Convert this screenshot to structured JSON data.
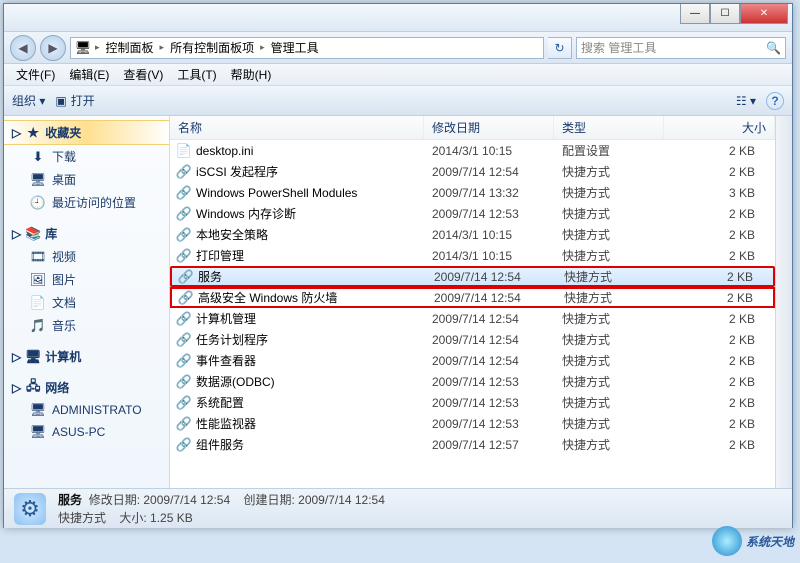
{
  "titlebar": {
    "minimize": "—",
    "maximize": "☐",
    "close": "✕"
  },
  "nav": {
    "back": "◀",
    "forward": "▶"
  },
  "breadcrumb": {
    "root_icon": "🖥",
    "items": [
      "控制面板",
      "所有控制面板项",
      "管理工具"
    ],
    "refresh": "↻"
  },
  "search": {
    "placeholder": "搜索 管理工具",
    "icon": "🔍"
  },
  "menubar": [
    "文件(F)",
    "编辑(E)",
    "查看(V)",
    "工具(T)",
    "帮助(H)"
  ],
  "toolbar": {
    "organize": "组织 ▾",
    "open_icon": "▣",
    "open": "打开",
    "view_icon": "☷ ▾",
    "help_icon": "?"
  },
  "sidebar": {
    "favorites": {
      "label": "收藏夹",
      "icon": "★",
      "expand": "▷",
      "items": [
        {
          "icon": "⬇",
          "label": "下载"
        },
        {
          "icon": "🖥",
          "label": "桌面"
        },
        {
          "icon": "🕘",
          "label": "最近访问的位置"
        }
      ]
    },
    "libraries": {
      "label": "库",
      "icon": "📚",
      "expand": "▷",
      "items": [
        {
          "icon": "🎞",
          "label": "视频"
        },
        {
          "icon": "🖼",
          "label": "图片"
        },
        {
          "icon": "📄",
          "label": "文档"
        },
        {
          "icon": "🎵",
          "label": "音乐"
        }
      ]
    },
    "computer": {
      "label": "计算机",
      "icon": "🖥",
      "expand": "▷"
    },
    "network": {
      "label": "网络",
      "icon": "🖧",
      "expand": "▷",
      "items": [
        {
          "icon": "🖥",
          "label": "ADMINISTRATO"
        },
        {
          "icon": "🖥",
          "label": "ASUS-PC"
        }
      ]
    }
  },
  "columns": {
    "name": "名称",
    "date": "修改日期",
    "type": "类型",
    "size": "大小"
  },
  "files": [
    {
      "icon": "📄",
      "name": "desktop.ini",
      "date": "2014/3/1 10:15",
      "type": "配置设置",
      "size": "2 KB",
      "sel": false,
      "hl": false
    },
    {
      "icon": "🔗",
      "name": "iSCSI 发起程序",
      "date": "2009/7/14 12:54",
      "type": "快捷方式",
      "size": "2 KB",
      "sel": false,
      "hl": false
    },
    {
      "icon": "🔗",
      "name": "Windows PowerShell Modules",
      "date": "2009/7/14 13:32",
      "type": "快捷方式",
      "size": "3 KB",
      "sel": false,
      "hl": false
    },
    {
      "icon": "🔗",
      "name": "Windows 内存诊断",
      "date": "2009/7/14 12:53",
      "type": "快捷方式",
      "size": "2 KB",
      "sel": false,
      "hl": false
    },
    {
      "icon": "🔗",
      "name": "本地安全策略",
      "date": "2014/3/1 10:15",
      "type": "快捷方式",
      "size": "2 KB",
      "sel": false,
      "hl": false
    },
    {
      "icon": "🔗",
      "name": "打印管理",
      "date": "2014/3/1 10:15",
      "type": "快捷方式",
      "size": "2 KB",
      "sel": false,
      "hl": false
    },
    {
      "icon": "🔗",
      "name": "服务",
      "date": "2009/7/14 12:54",
      "type": "快捷方式",
      "size": "2 KB",
      "sel": true,
      "hl": true
    },
    {
      "icon": "🔗",
      "name": "高级安全 Windows 防火墙",
      "date": "2009/7/14 12:54",
      "type": "快捷方式",
      "size": "2 KB",
      "sel": false,
      "hl": true
    },
    {
      "icon": "🔗",
      "name": "计算机管理",
      "date": "2009/7/14 12:54",
      "type": "快捷方式",
      "size": "2 KB",
      "sel": false,
      "hl": false
    },
    {
      "icon": "🔗",
      "name": "任务计划程序",
      "date": "2009/7/14 12:54",
      "type": "快捷方式",
      "size": "2 KB",
      "sel": false,
      "hl": false
    },
    {
      "icon": "🔗",
      "name": "事件查看器",
      "date": "2009/7/14 12:54",
      "type": "快捷方式",
      "size": "2 KB",
      "sel": false,
      "hl": false
    },
    {
      "icon": "🔗",
      "name": "数据源(ODBC)",
      "date": "2009/7/14 12:53",
      "type": "快捷方式",
      "size": "2 KB",
      "sel": false,
      "hl": false
    },
    {
      "icon": "🔗",
      "name": "系统配置",
      "date": "2009/7/14 12:53",
      "type": "快捷方式",
      "size": "2 KB",
      "sel": false,
      "hl": false
    },
    {
      "icon": "🔗",
      "name": "性能监视器",
      "date": "2009/7/14 12:53",
      "type": "快捷方式",
      "size": "2 KB",
      "sel": false,
      "hl": false
    },
    {
      "icon": "🔗",
      "name": "组件服务",
      "date": "2009/7/14 12:57",
      "type": "快捷方式",
      "size": "2 KB",
      "sel": false,
      "hl": false
    }
  ],
  "status": {
    "title": "服务",
    "line1a": "修改日期:",
    "line1b": "2009/7/14 12:54",
    "line1c": "创建日期:",
    "line1d": "2009/7/14 12:54",
    "line2a": "快捷方式",
    "line2b": "大小:",
    "line2c": "1.25 KB"
  },
  "watermark": "系统天地"
}
